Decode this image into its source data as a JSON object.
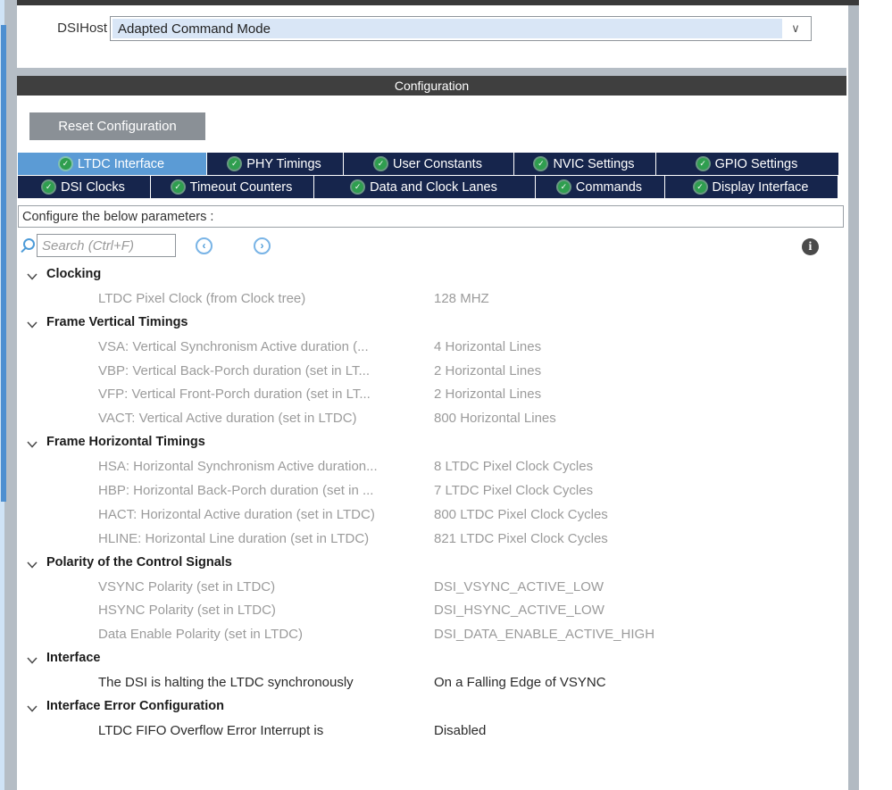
{
  "top": {
    "dsi_label": "DSIHost",
    "dsi_mode": "Adapted Command Mode"
  },
  "panel": {
    "title": "Configuration",
    "reset_button_label": "Reset Configuration",
    "params_header": "Configure the below parameters :"
  },
  "search": {
    "placeholder": "Search (Ctrl+F)",
    "value": ""
  },
  "icons": {
    "tab_check": "✓",
    "dropdown_caret": "∨",
    "prev": "‹",
    "next": "›",
    "info": "i",
    "search": "magnifier",
    "section_chevron": "chevron-down"
  },
  "colors": {
    "accent_blue": "#5b9bd5",
    "tab_navy": "#16254c",
    "check_green": "#2f9e4f",
    "header_gray": "#3f3f3f",
    "button_gray": "#8a9096",
    "muted_text": "#9b9b9b",
    "dropdown_fill": "#d9e6f6"
  },
  "tabs": {
    "row1": [
      {
        "label": "LTDC Interface",
        "selected": true
      },
      {
        "label": "PHY Timings",
        "selected": false
      },
      {
        "label": "User Constants",
        "selected": false
      },
      {
        "label": "NVIC Settings",
        "selected": false
      },
      {
        "label": "GPIO Settings",
        "selected": false
      }
    ],
    "row2": [
      {
        "label": "DSI Clocks",
        "selected": false
      },
      {
        "label": "Timeout Counters",
        "selected": false
      },
      {
        "label": "Data and Clock Lanes",
        "selected": false
      },
      {
        "label": "Commands",
        "selected": false
      },
      {
        "label": "Display Interface",
        "selected": false
      }
    ]
  },
  "tree": [
    {
      "type": "section",
      "label": "Clocking"
    },
    {
      "type": "param",
      "label": "LTDC Pixel Clock (from Clock tree)",
      "value": "128 MHZ",
      "state": "readonly"
    },
    {
      "type": "section",
      "label": "Frame Vertical Timings"
    },
    {
      "type": "param",
      "label": "VSA: Vertical Synchronism Active duration (...",
      "value": "4 Horizontal Lines",
      "state": "readonly"
    },
    {
      "type": "param",
      "label": "VBP: Vertical Back-Porch duration (set in LT...",
      "value": "2 Horizontal Lines",
      "state": "readonly"
    },
    {
      "type": "param",
      "label": "VFP: Vertical Front-Porch duration (set in LT...",
      "value": "2 Horizontal Lines",
      "state": "readonly"
    },
    {
      "type": "param",
      "label": "VACT: Vertical Active duration (set in LTDC)",
      "value": "800 Horizontal Lines",
      "state": "readonly"
    },
    {
      "type": "section",
      "label": "Frame Horizontal Timings"
    },
    {
      "type": "param",
      "label": "HSA: Horizontal Synchronism Active duration...",
      "value": "8 LTDC Pixel Clock Cycles",
      "state": "readonly"
    },
    {
      "type": "param",
      "label": "HBP: Horizontal Back-Porch duration (set in ...",
      "value": "7 LTDC Pixel Clock Cycles",
      "state": "readonly"
    },
    {
      "type": "param",
      "label": "HACT: Horizontal Active duration (set in LTDC)",
      "value": "800 LTDC Pixel Clock Cycles",
      "state": "readonly"
    },
    {
      "type": "param",
      "label": "HLINE: Horizontal Line duration (set in LTDC)",
      "value": "821 LTDC Pixel Clock Cycles",
      "state": "readonly"
    },
    {
      "type": "section",
      "label": "Polarity of the Control Signals"
    },
    {
      "type": "param",
      "label": "VSYNC Polarity (set in LTDC)",
      "value": "DSI_VSYNC_ACTIVE_LOW",
      "state": "readonly"
    },
    {
      "type": "param",
      "label": "HSYNC Polarity (set in LTDC)",
      "value": "DSI_HSYNC_ACTIVE_LOW",
      "state": "readonly"
    },
    {
      "type": "param",
      "label": "Data Enable Polarity (set in LTDC)",
      "value": "DSI_DATA_ENABLE_ACTIVE_HIGH",
      "state": "readonly"
    },
    {
      "type": "section",
      "label": "Interface"
    },
    {
      "type": "param",
      "label": "The DSI is halting the LTDC synchronously",
      "value": "On a Falling Edge of VSYNC",
      "state": "editable"
    },
    {
      "type": "section",
      "label": "Interface Error Configuration"
    },
    {
      "type": "param",
      "label": "LTDC FIFO Overflow Error Interrupt is",
      "value": "Disabled",
      "state": "editable"
    }
  ]
}
